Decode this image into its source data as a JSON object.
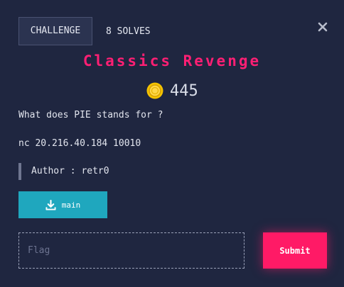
{
  "tabs": {
    "challenge_label": "CHALLENGE",
    "solves_label": "8 SOLVES"
  },
  "challenge": {
    "title": "Classics Revenge",
    "points": "445",
    "description": "What does PIE stands for ?",
    "connection": "nc 20.216.40.184 10010",
    "author": "Author : retr0"
  },
  "download": {
    "label": "main",
    "icon": "download-icon"
  },
  "flag": {
    "placeholder": "Flag",
    "value": ""
  },
  "submit_label": "Submit",
  "colors": {
    "background": "#1f2640",
    "title": "#ff1f74",
    "download_button": "#1fa7be",
    "submit_button": "#ff1a66",
    "coin": "#f5c400"
  }
}
